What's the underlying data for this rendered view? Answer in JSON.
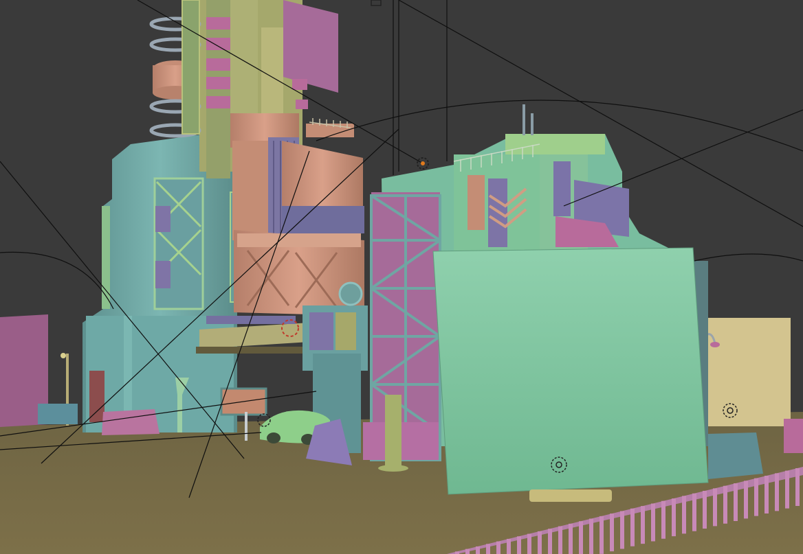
{
  "viewport": {
    "mode": "solid-shading",
    "colors": {
      "background": "#3a3a3a",
      "ground": "#766a45",
      "teal": "#6fa6a3",
      "teal_dark": "#4e7f7d",
      "olive": "#a6a86a",
      "salmon": "#c9917a",
      "pink": "#a66b99",
      "violet": "#7f74a6",
      "mint": "#7fc59e",
      "sand": "#d3c48f",
      "wire": "#111111"
    },
    "objects": [
      {
        "name": "central-tower",
        "icon": "mesh-icon"
      },
      {
        "name": "left-teal-building",
        "icon": "mesh-icon"
      },
      {
        "name": "scaffold-building",
        "icon": "mesh-icon"
      },
      {
        "name": "green-billboard",
        "icon": "plane-icon"
      },
      {
        "name": "parked-car",
        "icon": "mesh-icon"
      },
      {
        "name": "street-light",
        "icon": "light-icon"
      },
      {
        "name": "pink-railing",
        "icon": "mesh-icon"
      },
      {
        "name": "camera-path",
        "icon": "curve-icon"
      }
    ]
  }
}
